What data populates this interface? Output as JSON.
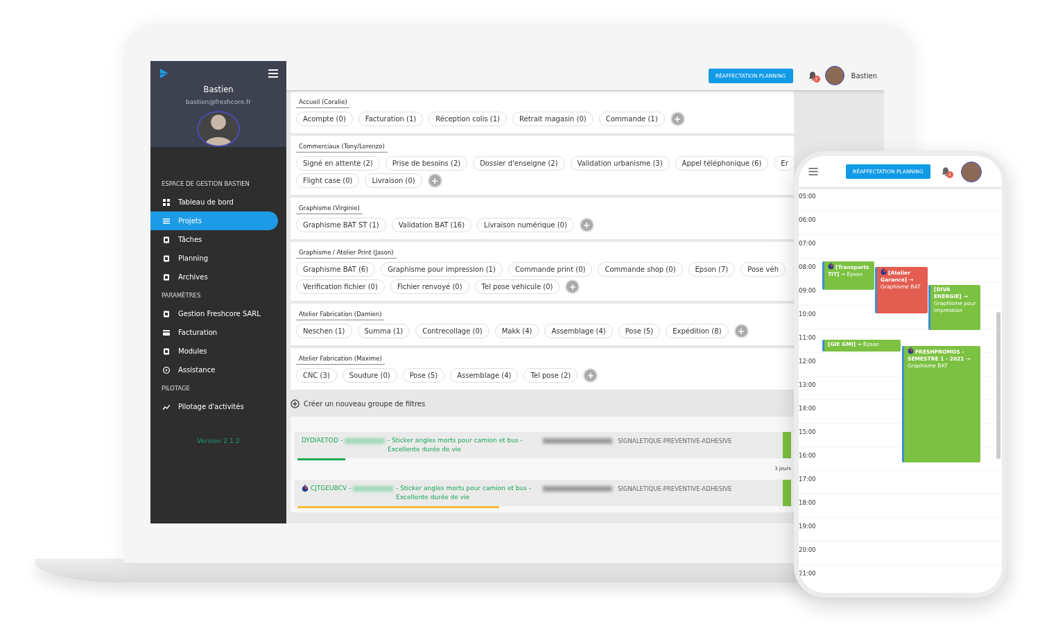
{
  "laptop": {
    "sidebar": {
      "user_name": "Bastien",
      "email": "bastien@freshcore.fr",
      "version": "Version 2.1.2",
      "sections": [
        {
          "title": "ESPACE DE GESTION BASTIEN",
          "items": [
            {
              "label": "Tableau de bord",
              "selected": false
            },
            {
              "label": "Projets",
              "selected": true
            },
            {
              "label": "Tâches",
              "selected": false
            },
            {
              "label": "Planning",
              "selected": false
            },
            {
              "label": "Archives",
              "selected": false
            }
          ]
        },
        {
          "title": "PARAMÈTRES",
          "items": [
            {
              "label": "Gestion Freshcore SARL",
              "selected": false
            },
            {
              "label": "Facturation",
              "selected": false
            },
            {
              "label": "Modules",
              "selected": false
            },
            {
              "label": "Assistance",
              "selected": false
            }
          ]
        },
        {
          "title": "PILOTAGE",
          "items": [
            {
              "label": "Pilotage d'activités",
              "selected": false
            }
          ]
        }
      ]
    },
    "header": {
      "button": "RÉAFFECTATION PLANNING",
      "notifications": "2",
      "user_name": "Bastien"
    },
    "filter_groups": [
      {
        "title": "Accueil (Coralie)",
        "rows": [
          [
            "Acompte (0)",
            "Facturation (1)",
            "Réception colis (1)",
            "Retrait magasin (0)",
            "Commande (1)"
          ]
        ]
      },
      {
        "title": "Commerciaux (Tony/Lorenzo)",
        "rows": [
          [
            "Signé en attente (2)",
            "Prise de besoins (2)",
            "Dossier d'enseigne (2)",
            "Validation urbanisme (3)",
            "Appel téléphonique (6)",
            "Er"
          ],
          [
            "Flight case (0)",
            "Livraison (0)"
          ]
        ]
      },
      {
        "title": "Graphisme (Virginie)",
        "rows": [
          [
            "Graphisme BAT ST (1)",
            "Validation BAT (16)",
            "Livraison numérique (0)"
          ]
        ]
      },
      {
        "title": "Graphisme / Atelier Print (Jason)",
        "rows": [
          [
            "Graphisme BAT (6)",
            "Graphisme pour impression (1)",
            "Commande print (0)",
            "Commande shop (0)",
            "Epson (7)",
            "Pose véh"
          ],
          [
            "Verification fichier (0)",
            "Fichier renvoyé (0)",
            "Tel pose véhicule (0)"
          ]
        ]
      },
      {
        "title": "Atelier Fabrication (Damien)",
        "rows": [
          [
            "Neschen (1)",
            "Summa (1)",
            "Contrecollage (0)",
            "Makk (4)",
            "Assemblage (4)",
            "Pose (5)",
            "Expédition (8)"
          ]
        ]
      },
      {
        "title": "Atelier Fabrication (Maxime)",
        "rows": [
          [
            "CNC (3)",
            "Soudure (0)",
            "Pose (5)",
            "Assemblage (4)",
            "Tel pose (2)"
          ]
        ]
      }
    ],
    "new_group": "Créer un nouveau groupe de filtres",
    "projects": [
      {
        "timer": false,
        "code": "DYDIAETOD -",
        "description": "- Sticker angles morts pour camion et bus - Excellente durée de vie",
        "category": "SIGNALETIQUE-PREVENTIVE-ADHESIVE",
        "level": 0.1,
        "color": "#1aaa55",
        "due": "3 jours"
      },
      {
        "timer": true,
        "code": "CJTGEUBCV -",
        "description": "- Sticker angles morts pour camion et bus - Excellente durée de vie",
        "category": "SIGNALETIQUE-PREVENTIVE-ADHESIVE",
        "level": 0.42,
        "color": "#f6b93b"
      }
    ]
  },
  "phone": {
    "header": {
      "button": "RÉAFFECTATION PLANNING",
      "notifications": "2"
    },
    "hours": [
      "05:00",
      "06:00",
      "07:00",
      "08:00",
      "09:00",
      "10:00",
      "11:00",
      "12:00",
      "13:00",
      "14:00",
      "15:00",
      "16:00",
      "17:00",
      "18:00",
      "19:00",
      "20:00",
      "21:00"
    ],
    "events": [
      {
        "text": "**[Transports TIT]** → Epson",
        "timer": true,
        "color": "#7cc142"
      },
      {
        "text": "**[Atelier Garance] →** Graphisme BAT",
        "timer": true,
        "color": "#e35d50"
      },
      {
        "text": "**[DIVA ENERGIE] →** Graphisme pour impression",
        "timer": false,
        "color": "#7cc142"
      },
      {
        "text": "**[GIE GMI]** → Epson",
        "timer": false,
        "color": "#7cc142"
      },
      {
        "text": "**FRESHPROMOS - SEMESTRE 1 - 2021 →** Graphisme BAT",
        "timer": true,
        "color": "#7cc142"
      }
    ]
  }
}
